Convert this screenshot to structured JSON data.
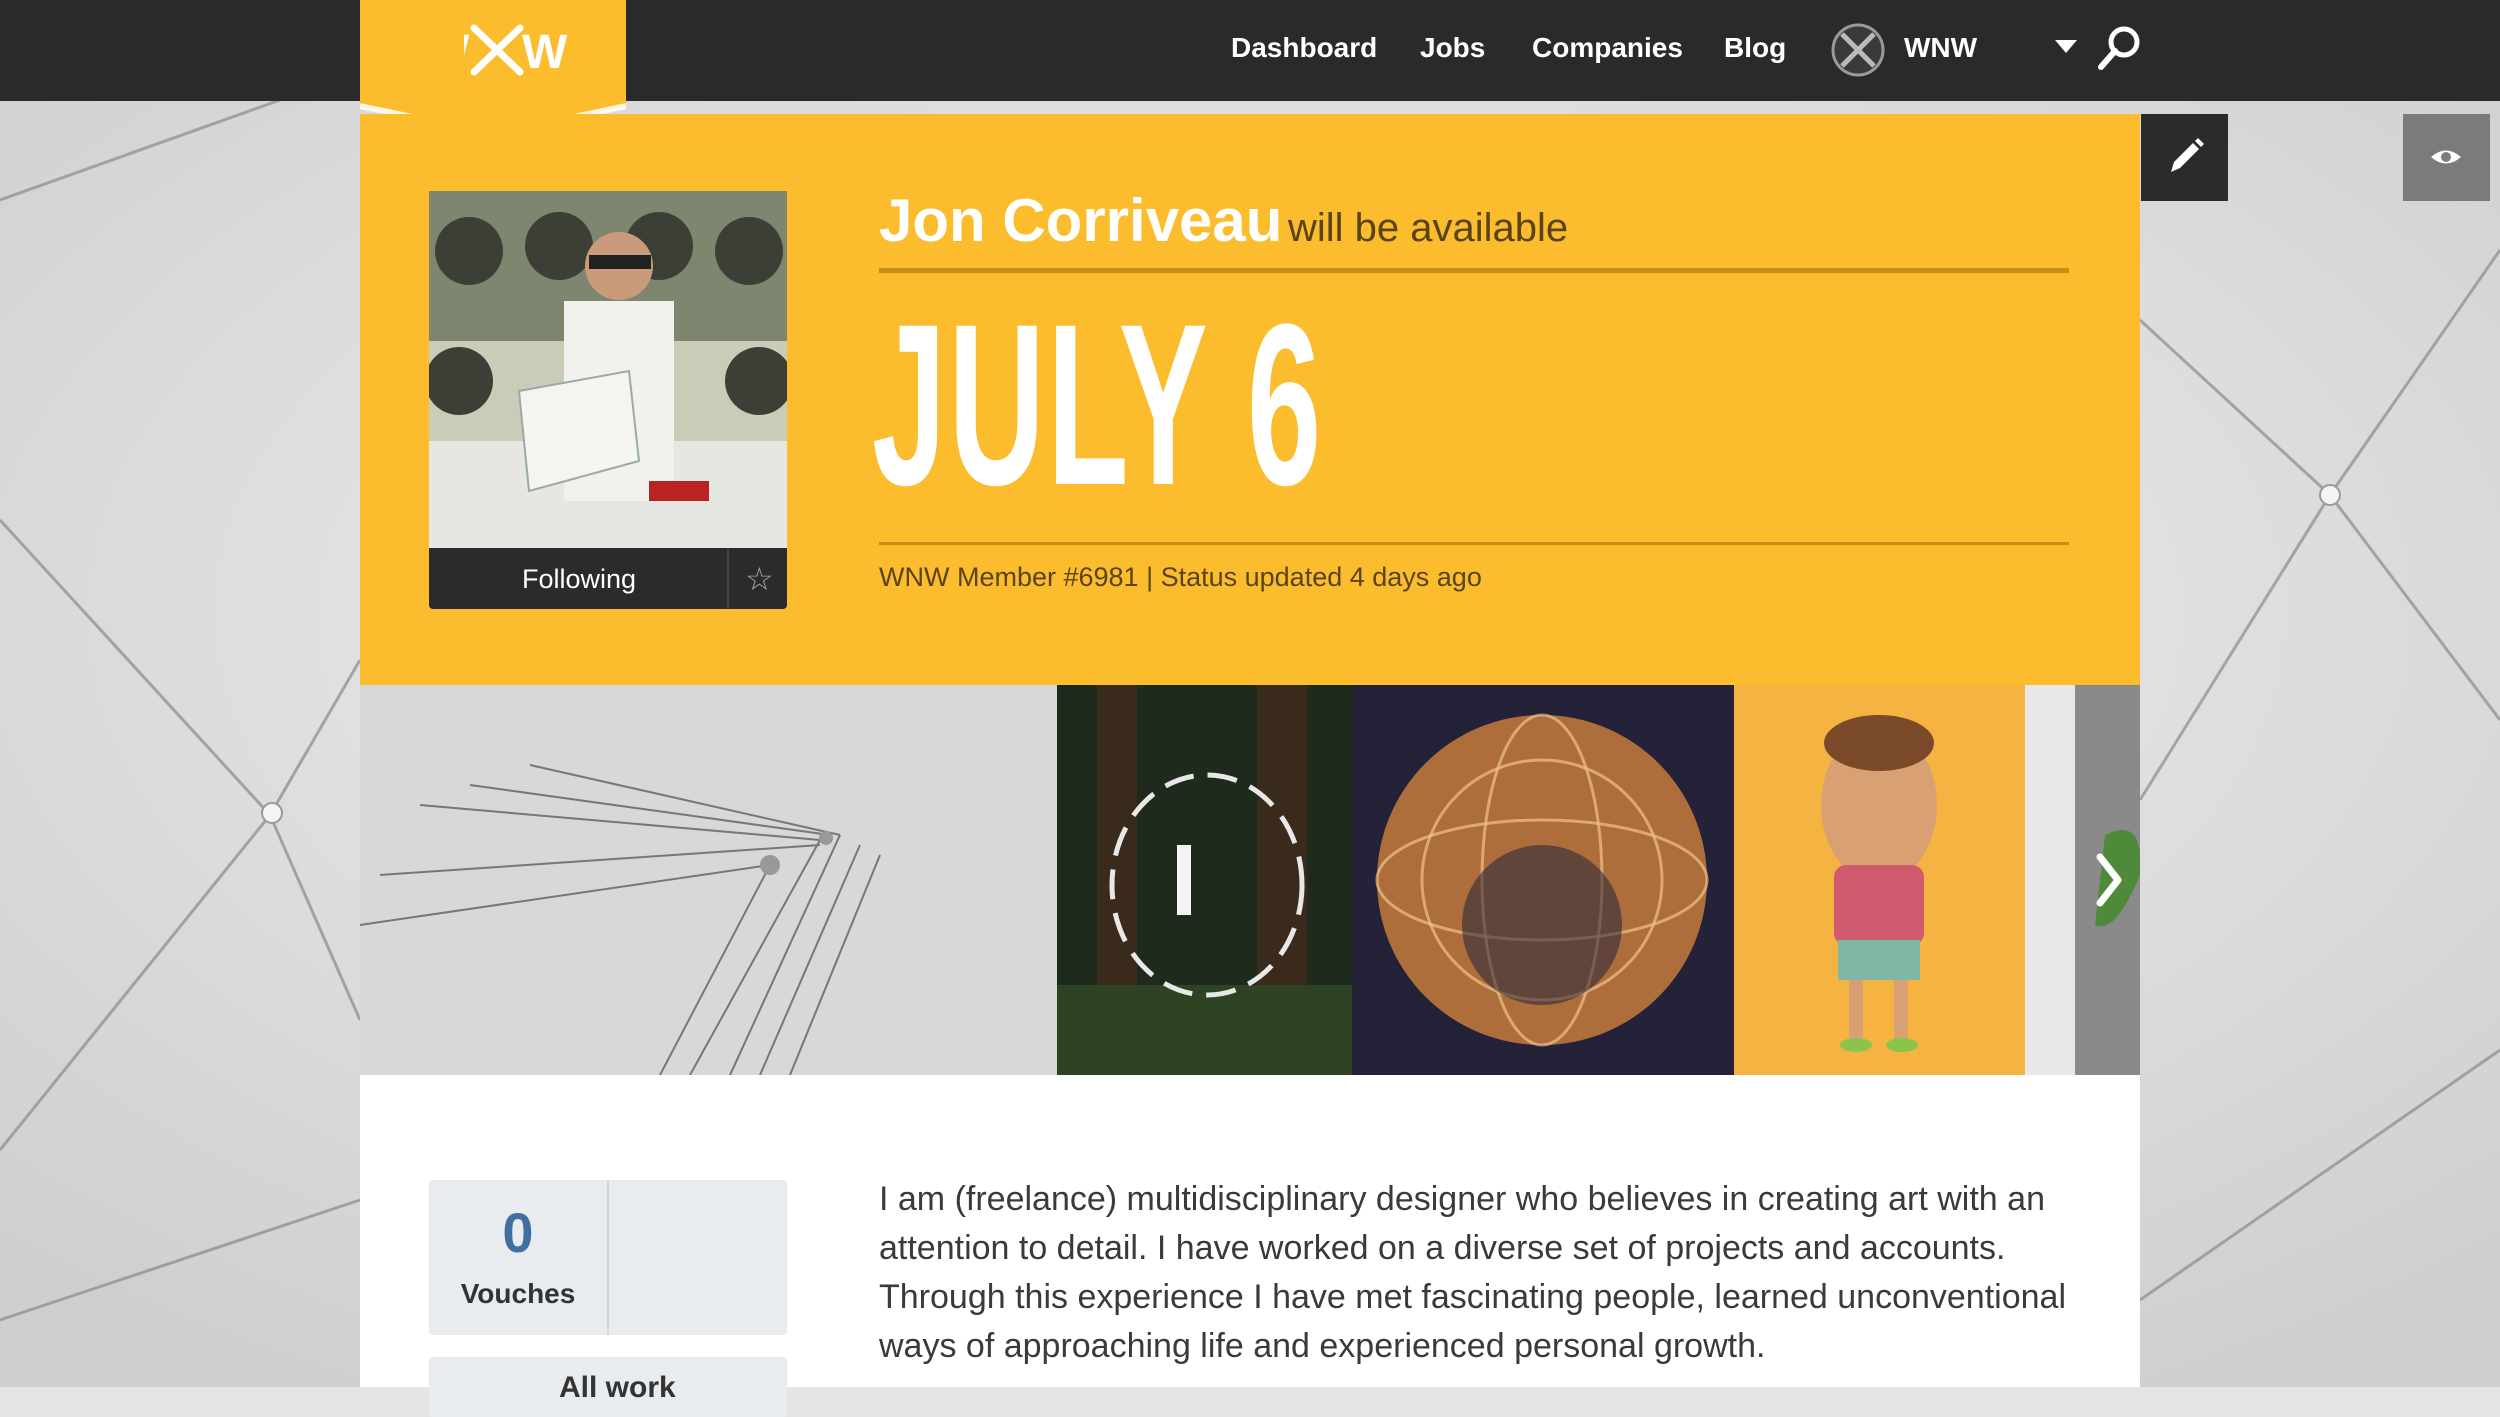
{
  "nav": {
    "logo": "WXW",
    "items": [
      "Dashboard",
      "Jobs",
      "Companies",
      "Blog"
    ],
    "account_label": "WNW",
    "account_icon": "wnw-avatar-icon",
    "menu_icon": "caret-down-icon",
    "search_icon": "search-icon"
  },
  "profile": {
    "name": "Jon Corriveau",
    "availability_phrase": "will be available",
    "available_date": "JULY 6",
    "meta": "WNW Member #6981 | Status updated 4 days ago",
    "follow_label": "Following",
    "star_icon": "star-outline-icon"
  },
  "actions": {
    "edit_icon": "pencil-icon",
    "view_icon": "eye-icon"
  },
  "gallery": {
    "next_icon": "chevron-right-icon",
    "item_count_visible": 5
  },
  "stats": {
    "vouches_count": "0",
    "vouches_label": "Vouches",
    "second_label": "All work"
  },
  "bio": "I am (freelance) multidisciplinary designer who believes in creating art with an attention to detail. I have worked on a diverse set of projects and accounts. Through this experience I have met fascinating people, learned unconventional ways of approaching life and experienced personal growth.",
  "colors": {
    "accent": "#fbbc2d",
    "topbar": "#2a2a2a",
    "accent_dark": "#c48e15",
    "stat_number": "#3f6f9f"
  }
}
